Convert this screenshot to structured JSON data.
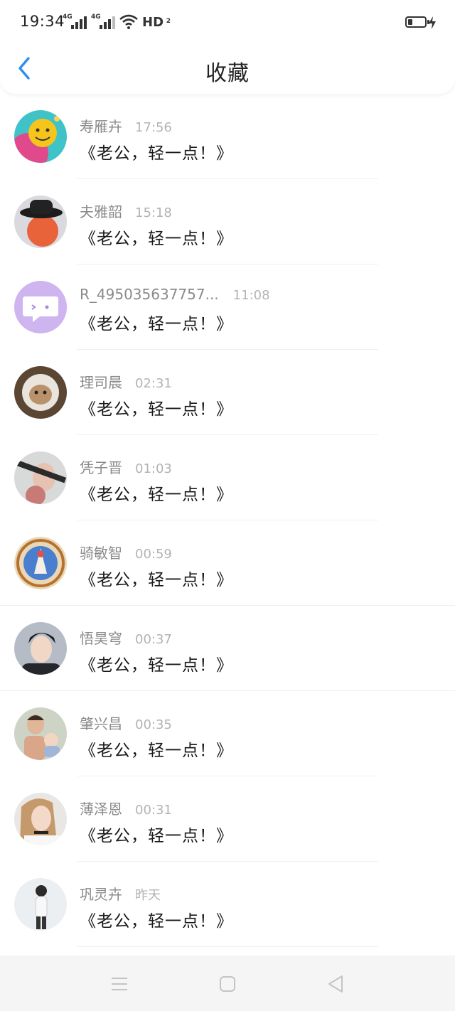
{
  "status_bar": {
    "time": "19:34",
    "network_1": "4G",
    "network_2": "4G",
    "hd_label": "HD",
    "hd_sub": "2",
    "icons": [
      "signal-icon",
      "signal-icon",
      "wifi-icon",
      "battery-icon",
      "charging-icon"
    ]
  },
  "nav": {
    "title": "收藏",
    "back_icon": "chevron-left-icon"
  },
  "favorites": [
    {
      "name": "寿雁卉",
      "time": "17:56",
      "title": "《老公，轻一点！》"
    },
    {
      "name": "夫雅韶",
      "time": "15:18",
      "title": "《老公，轻一点！》"
    },
    {
      "name": "R_495035637757...",
      "time": "11:08",
      "title": "《老公，轻一点！》"
    },
    {
      "name": "理司晨",
      "time": "02:31",
      "title": "《老公，轻一点！》"
    },
    {
      "name": "凭子晋",
      "time": "01:03",
      "title": "《老公，轻一点！》"
    },
    {
      "name": "骑敏智",
      "time": "00:59",
      "title": "《老公，轻一点！》"
    },
    {
      "name": "悟昊穹",
      "time": "00:37",
      "title": "《老公，轻一点！》"
    },
    {
      "name": "肇兴昌",
      "time": "00:35",
      "title": "《老公，轻一点！》"
    },
    {
      "name": "薄泽恩",
      "time": "00:31",
      "title": "《老公，轻一点！》"
    },
    {
      "name": "巩灵卉",
      "time": "昨天",
      "title": "《老公，轻一点！》"
    }
  ],
  "system_nav": {
    "icons": [
      "menu-icon",
      "home-square-icon",
      "back-triangle-icon"
    ]
  },
  "colors": {
    "accent": "#2b8ff0",
    "name_text": "#8a8a8a",
    "time_text": "#b3b3b3",
    "title_text": "#1a1a1a"
  }
}
